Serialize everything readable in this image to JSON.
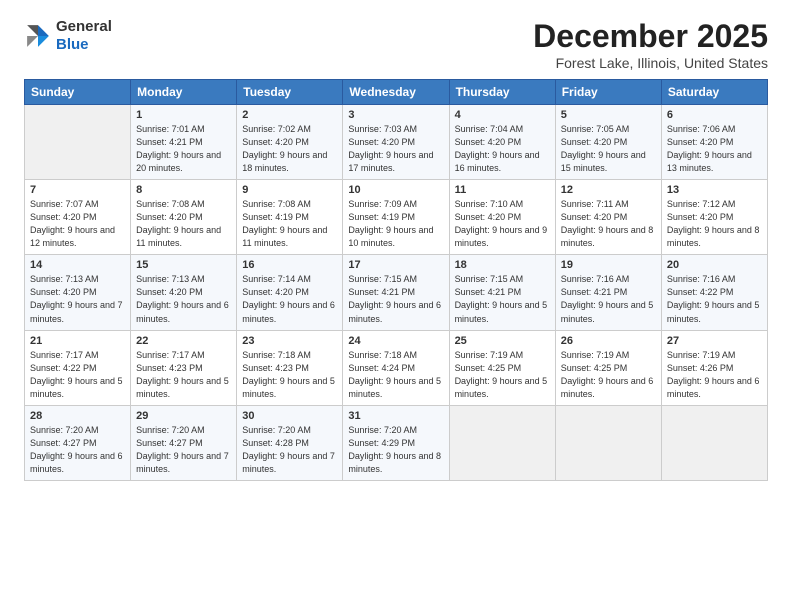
{
  "header": {
    "logo_general": "General",
    "logo_blue": "Blue",
    "month_title": "December 2025",
    "location": "Forest Lake, Illinois, United States"
  },
  "days_of_week": [
    "Sunday",
    "Monday",
    "Tuesday",
    "Wednesday",
    "Thursday",
    "Friday",
    "Saturday"
  ],
  "weeks": [
    [
      {
        "day": "",
        "empty": true
      },
      {
        "day": "1",
        "sunrise": "7:01 AM",
        "sunset": "4:21 PM",
        "daylight": "9 hours and 20 minutes."
      },
      {
        "day": "2",
        "sunrise": "7:02 AM",
        "sunset": "4:20 PM",
        "daylight": "9 hours and 18 minutes."
      },
      {
        "day": "3",
        "sunrise": "7:03 AM",
        "sunset": "4:20 PM",
        "daylight": "9 hours and 17 minutes."
      },
      {
        "day": "4",
        "sunrise": "7:04 AM",
        "sunset": "4:20 PM",
        "daylight": "9 hours and 16 minutes."
      },
      {
        "day": "5",
        "sunrise": "7:05 AM",
        "sunset": "4:20 PM",
        "daylight": "9 hours and 15 minutes."
      },
      {
        "day": "6",
        "sunrise": "7:06 AM",
        "sunset": "4:20 PM",
        "daylight": "9 hours and 13 minutes."
      }
    ],
    [
      {
        "day": "7",
        "sunrise": "7:07 AM",
        "sunset": "4:20 PM",
        "daylight": "9 hours and 12 minutes."
      },
      {
        "day": "8",
        "sunrise": "7:08 AM",
        "sunset": "4:20 PM",
        "daylight": "9 hours and 11 minutes."
      },
      {
        "day": "9",
        "sunrise": "7:08 AM",
        "sunset": "4:19 PM",
        "daylight": "9 hours and 11 minutes."
      },
      {
        "day": "10",
        "sunrise": "7:09 AM",
        "sunset": "4:19 PM",
        "daylight": "9 hours and 10 minutes."
      },
      {
        "day": "11",
        "sunrise": "7:10 AM",
        "sunset": "4:20 PM",
        "daylight": "9 hours and 9 minutes."
      },
      {
        "day": "12",
        "sunrise": "7:11 AM",
        "sunset": "4:20 PM",
        "daylight": "9 hours and 8 minutes."
      },
      {
        "day": "13",
        "sunrise": "7:12 AM",
        "sunset": "4:20 PM",
        "daylight": "9 hours and 8 minutes."
      }
    ],
    [
      {
        "day": "14",
        "sunrise": "7:13 AM",
        "sunset": "4:20 PM",
        "daylight": "9 hours and 7 minutes."
      },
      {
        "day": "15",
        "sunrise": "7:13 AM",
        "sunset": "4:20 PM",
        "daylight": "9 hours and 6 minutes."
      },
      {
        "day": "16",
        "sunrise": "7:14 AM",
        "sunset": "4:20 PM",
        "daylight": "9 hours and 6 minutes."
      },
      {
        "day": "17",
        "sunrise": "7:15 AM",
        "sunset": "4:21 PM",
        "daylight": "9 hours and 6 minutes."
      },
      {
        "day": "18",
        "sunrise": "7:15 AM",
        "sunset": "4:21 PM",
        "daylight": "9 hours and 5 minutes."
      },
      {
        "day": "19",
        "sunrise": "7:16 AM",
        "sunset": "4:21 PM",
        "daylight": "9 hours and 5 minutes."
      },
      {
        "day": "20",
        "sunrise": "7:16 AM",
        "sunset": "4:22 PM",
        "daylight": "9 hours and 5 minutes."
      }
    ],
    [
      {
        "day": "21",
        "sunrise": "7:17 AM",
        "sunset": "4:22 PM",
        "daylight": "9 hours and 5 minutes."
      },
      {
        "day": "22",
        "sunrise": "7:17 AM",
        "sunset": "4:23 PM",
        "daylight": "9 hours and 5 minutes."
      },
      {
        "day": "23",
        "sunrise": "7:18 AM",
        "sunset": "4:23 PM",
        "daylight": "9 hours and 5 minutes."
      },
      {
        "day": "24",
        "sunrise": "7:18 AM",
        "sunset": "4:24 PM",
        "daylight": "9 hours and 5 minutes."
      },
      {
        "day": "25",
        "sunrise": "7:19 AM",
        "sunset": "4:25 PM",
        "daylight": "9 hours and 5 minutes."
      },
      {
        "day": "26",
        "sunrise": "7:19 AM",
        "sunset": "4:25 PM",
        "daylight": "9 hours and 6 minutes."
      },
      {
        "day": "27",
        "sunrise": "7:19 AM",
        "sunset": "4:26 PM",
        "daylight": "9 hours and 6 minutes."
      }
    ],
    [
      {
        "day": "28",
        "sunrise": "7:20 AM",
        "sunset": "4:27 PM",
        "daylight": "9 hours and 6 minutes."
      },
      {
        "day": "29",
        "sunrise": "7:20 AM",
        "sunset": "4:27 PM",
        "daylight": "9 hours and 7 minutes."
      },
      {
        "day": "30",
        "sunrise": "7:20 AM",
        "sunset": "4:28 PM",
        "daylight": "9 hours and 7 minutes."
      },
      {
        "day": "31",
        "sunrise": "7:20 AM",
        "sunset": "4:29 PM",
        "daylight": "9 hours and 8 minutes."
      },
      {
        "day": "",
        "empty": true
      },
      {
        "day": "",
        "empty": true
      },
      {
        "day": "",
        "empty": true
      }
    ]
  ],
  "labels": {
    "sunrise": "Sunrise:",
    "sunset": "Sunset:",
    "daylight": "Daylight:"
  }
}
